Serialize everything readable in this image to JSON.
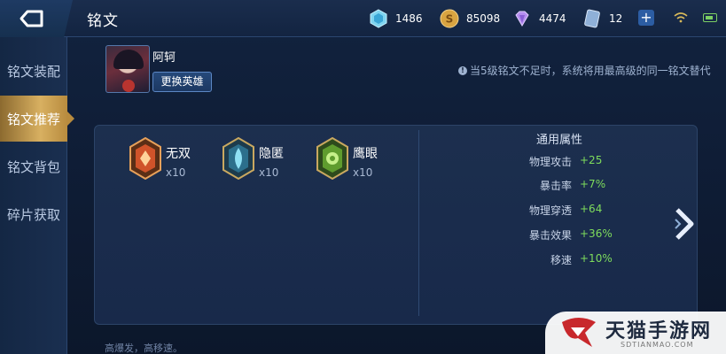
{
  "header": {
    "title": "铭文",
    "back_icon": "back-arrow-icon",
    "resources": {
      "diamond": "1486",
      "gold": "85098",
      "gem": "4474",
      "ticket": "12"
    },
    "add_icon": "plus-icon",
    "status_icons": [
      "wifi-icon",
      "battery-icon"
    ]
  },
  "sidebar": {
    "items": [
      {
        "label": "铭文装配",
        "active": false
      },
      {
        "label": "铭文推荐",
        "active": true
      },
      {
        "label": "铭文背包",
        "active": false
      },
      {
        "label": "碎片获取",
        "active": false
      }
    ]
  },
  "hero": {
    "name": "阿轲",
    "change_label": "更换英雄"
  },
  "notice": "当5级铭文不足时，系统将用最高级的同一铭文替代",
  "runes": [
    {
      "name": "无双",
      "count": "x10",
      "color": "#d0532a"
    },
    {
      "name": "隐匿",
      "count": "x10",
      "color": "#5fb6d6"
    },
    {
      "name": "鹰眼",
      "count": "x10",
      "color": "#7dbb3f"
    }
  ],
  "attributes": {
    "title": "通用属性",
    "rows": [
      {
        "name": "物理攻击",
        "value": "+25"
      },
      {
        "name": "暴击率",
        "value": "+7%"
      },
      {
        "name": "物理穿透",
        "value": "+64"
      },
      {
        "name": "暴击效果",
        "value": "+36%"
      },
      {
        "name": "移速",
        "value": "+10%"
      }
    ]
  },
  "footer": "高爆发，高移速。",
  "watermark": {
    "title": "天猫手游网",
    "subtitle": "SDTIANMAO.COM"
  }
}
